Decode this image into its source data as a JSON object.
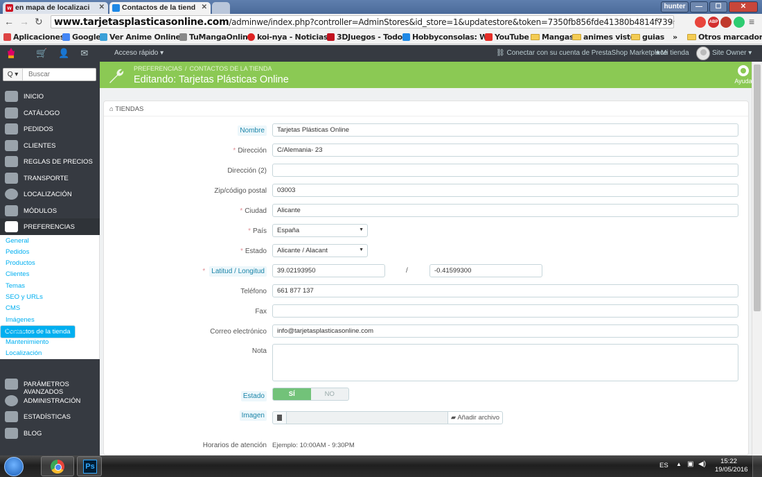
{
  "browser": {
    "tabs": [
      {
        "label": "en mapa de localizaci",
        "active": false
      },
      {
        "label": "Contactos de la tiend",
        "active": true
      }
    ],
    "window_user": "hunter",
    "url_bold": "www.tarjetasplasticasonline.com",
    "url_rest": "/adminwe/index.php?controller=AdminStores&id_store=1&updatestore&token=7350fb856fde41380b4814f73915",
    "bookmarks": [
      {
        "label": "Aplicaciones",
        "icon": "apps-grid-icon",
        "color": "#d44"
      },
      {
        "label": "Google",
        "icon": "google-icon",
        "color": "#4285f4"
      },
      {
        "label": "Ver Anime Online",
        "icon": "anime-icon",
        "color": "#3aa0d8"
      },
      {
        "label": "TuMangaOnline",
        "icon": "manga-icon",
        "color": "#888"
      },
      {
        "label": "koi-nya - Noticias",
        "icon": "koinya-icon",
        "color": "#d22"
      },
      {
        "label": "3DJuegos - Todo",
        "icon": "3djuegos-icon",
        "color": "#c1121f"
      },
      {
        "label": "Hobbyconsolas: W",
        "icon": "hobbyconsolas-icon",
        "color": "#1e88e5"
      },
      {
        "label": "YouTube",
        "icon": "youtube-icon",
        "color": "#e52d27"
      },
      {
        "label": "Mangas",
        "icon": "folder-icon",
        "color": "#f4cc54"
      },
      {
        "label": "animes visto",
        "icon": "folder-icon",
        "color": "#f4cc54"
      },
      {
        "label": "guias",
        "icon": "folder-icon",
        "color": "#f4cc54"
      }
    ],
    "bookmarks_overflow": "»",
    "other_bookmarks": "Otros marcadores"
  },
  "header": {
    "quick_access": "Acceso rápido ▾",
    "marketplace": "Conectar con su cuenta de PrestaShop Marketplace",
    "my_shop": "Mi tienda",
    "user": "Site Owner ▾"
  },
  "sidebar": {
    "search_placeholder": "Buscar",
    "items": [
      {
        "label": "Inicio",
        "icon": "dashboard-icon"
      },
      {
        "label": "Catálogo",
        "icon": "catalog-icon"
      },
      {
        "label": "Pedidos",
        "icon": "orders-icon"
      },
      {
        "label": "Clientes",
        "icon": "customers-icon"
      },
      {
        "label": "Reglas de precios",
        "icon": "price-rules-icon"
      },
      {
        "label": "Transporte",
        "icon": "truck-icon"
      },
      {
        "label": "Localización",
        "icon": "globe-icon"
      },
      {
        "label": "Módulos",
        "icon": "puzzle-icon"
      },
      {
        "label": "Preferencias",
        "icon": "wrench-icon"
      }
    ],
    "subitems": [
      "General",
      "Pedidos",
      "Productos",
      "Clientes",
      "Temas",
      "SEO y URLs",
      "CMS",
      "Imágenes",
      "Contactos de la tienda",
      "Buscar",
      "Mantenimiento",
      "Localización"
    ],
    "items_after": [
      {
        "label": "Parámetros avanzados",
        "icon": "cogs-icon"
      },
      {
        "label": "Administración",
        "icon": "gear-icon"
      },
      {
        "label": "Estadísticas",
        "icon": "stats-icon"
      },
      {
        "label": "Blog",
        "icon": "blog-icon"
      }
    ]
  },
  "page": {
    "breadcrumb": [
      "Preferencias",
      "Contactos de la tienda"
    ],
    "breadcrumb_sep": "/",
    "title": "Editando: Tarjetas Plásticas Online",
    "help": "Ayuda"
  },
  "form": {
    "panel_title": "Tiendas",
    "fields": {
      "nombre": {
        "label": "Nombre",
        "value": "Tarjetas Plásticas Online"
      },
      "direccion": {
        "label": "Dirección",
        "value": "C/Alemania- 23"
      },
      "direccion2": {
        "label": "Dirección (2)",
        "value": ""
      },
      "zip": {
        "label": "Zip/código postal",
        "value": "03003"
      },
      "ciudad": {
        "label": "Ciudad",
        "value": "Alicante"
      },
      "pais": {
        "label": "País",
        "value": "España"
      },
      "estado": {
        "label": "Estado",
        "value": "Alicante / Alacant"
      },
      "latlng": {
        "label": "Latitud / Longitud",
        "lat": "39.02193950",
        "lng": "-0.41599300",
        "sep": "/"
      },
      "telefono": {
        "label": "Teléfono",
        "value": "661 877 137"
      },
      "fax": {
        "label": "Fax",
        "value": ""
      },
      "email": {
        "label": "Correo electrónico",
        "value": "info@tarjetasplasticasonline.com"
      },
      "nota": {
        "label": "Nota",
        "value": ""
      },
      "estado_toggle": {
        "label": "Estado",
        "on": "SÍ",
        "off": "NO"
      },
      "imagen": {
        "label": "Imagen",
        "button": "Añadir archivo"
      },
      "horarios": {
        "label": "Horarios de atención",
        "example": "Ejemplo: 10:00AM - 9:30PM"
      }
    }
  },
  "taskbar": {
    "lang": "ES",
    "time": "15:22",
    "date": "19/05/2016",
    "ps_label": "Ps"
  },
  "colors": {
    "header_green": "#8bc954",
    "sidebar_dark": "#363a41",
    "accent_blue": "#00aff0",
    "toggle_green": "#72c279"
  }
}
